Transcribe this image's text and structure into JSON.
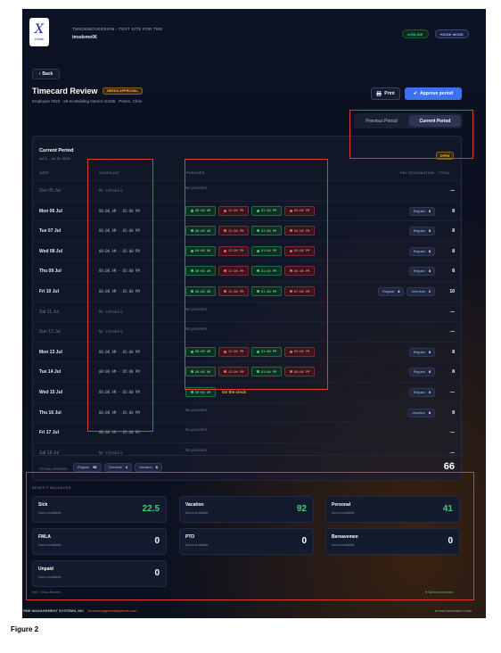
{
  "header": {
    "logo_letter": "X",
    "logo_caption": "Kiosk",
    "site_title": "TMSDEMOVERSION - TEST SITE FOR TMS",
    "site_user": "tmsdemo06",
    "status_online": "ONLINE",
    "status_kiosk": "KIOSK MODE"
  },
  "toolbar": {
    "back_label": "Back",
    "print_label": "Print",
    "approve_label": "Approve period"
  },
  "page": {
    "title": "Timecard Review",
    "approval_badge": "NEEDS APPROVAL",
    "employee_line": "Employee #222 · 20-mi-Building Interior-10185 · Peters, Chris"
  },
  "period_toggle": {
    "previous": "Previous Period",
    "current": "Current Period"
  },
  "card": {
    "title": "Current Period",
    "dates": "Jul 5 – Jul 18, 2026",
    "status": "OPEN",
    "columns": {
      "date": "DATE",
      "schedule": "SCHEDULE",
      "punches": "PUNCHES",
      "pay": "PAY DESIGNATION · TOTAL"
    }
  },
  "rows": [
    {
      "day": "Sun 05 Jul",
      "weekend": true,
      "schedule": "No schedule",
      "punches": [],
      "no_punch": "No punches",
      "on_clock": "",
      "pay": [],
      "total": "—"
    },
    {
      "day": "Mon 06 Jul",
      "weekend": false,
      "schedule": "08:00 AM - 05:00 PM",
      "punches": [
        {
          "t": "08:00 AM",
          "k": "in"
        },
        {
          "t": "12:00 PM",
          "k": "out"
        },
        {
          "t": "01:00 PM",
          "k": "in"
        },
        {
          "t": "05:00 PM",
          "k": "out"
        }
      ],
      "no_punch": "",
      "on_clock": "",
      "pay": [
        {
          "l": "Regular",
          "v": "8"
        }
      ],
      "total": "8"
    },
    {
      "day": "Tue 07 Jul",
      "weekend": false,
      "schedule": "08:00 AM - 05:00 PM",
      "punches": [
        {
          "t": "08:00 AM",
          "k": "in"
        },
        {
          "t": "12:00 PM",
          "k": "out"
        },
        {
          "t": "01:00 PM",
          "k": "in"
        },
        {
          "t": "05:00 PM",
          "k": "out"
        }
      ],
      "no_punch": "",
      "on_clock": "",
      "pay": [
        {
          "l": "Regular",
          "v": "8"
        }
      ],
      "total": "8"
    },
    {
      "day": "Wed 08 Jul",
      "weekend": false,
      "schedule": "08:00 AM - 05:00 PM",
      "punches": [
        {
          "t": "08:00 AM",
          "k": "in"
        },
        {
          "t": "12:00 PM",
          "k": "out"
        },
        {
          "t": "01:00 PM",
          "k": "in"
        },
        {
          "t": "05:00 PM",
          "k": "out"
        }
      ],
      "no_punch": "",
      "on_clock": "",
      "pay": [
        {
          "l": "Regular",
          "v": "8"
        }
      ],
      "total": "8"
    },
    {
      "day": "Thu 09 Jul",
      "weekend": false,
      "schedule": "08:00 AM - 05:00 PM",
      "punches": [
        {
          "t": "08:00 AM",
          "k": "in"
        },
        {
          "t": "12:00 PM",
          "k": "out"
        },
        {
          "t": "01:00 PM",
          "k": "in"
        },
        {
          "t": "05:00 PM",
          "k": "out"
        }
      ],
      "no_punch": "",
      "on_clock": "",
      "pay": [
        {
          "l": "Regular",
          "v": "8"
        }
      ],
      "total": "8"
    },
    {
      "day": "Fri 10 Jul",
      "weekend": false,
      "schedule": "08:00 AM - 05:00 PM",
      "punches": [
        {
          "t": "08:00 AM",
          "k": "in"
        },
        {
          "t": "12:00 PM",
          "k": "out"
        },
        {
          "t": "01:00 PM",
          "k": "in"
        },
        {
          "t": "07:00 PM",
          "k": "out"
        }
      ],
      "no_punch": "",
      "on_clock": "",
      "pay": [
        {
          "l": "Regular",
          "v": "8"
        },
        {
          "l": "Overtime",
          "v": "2"
        }
      ],
      "total": "10"
    },
    {
      "day": "Sat 11 Jul",
      "weekend": true,
      "schedule": "No schedule",
      "punches": [],
      "no_punch": "No punches",
      "on_clock": "",
      "pay": [],
      "total": "—"
    },
    {
      "day": "Sun 12 Jul",
      "weekend": true,
      "schedule": "No schedule",
      "punches": [],
      "no_punch": "No punches",
      "on_clock": "",
      "pay": [],
      "total": "—"
    },
    {
      "day": "Mon 13 Jul",
      "weekend": false,
      "schedule": "08:00 AM - 05:00 PM",
      "punches": [
        {
          "t": "08:00 AM",
          "k": "in"
        },
        {
          "t": "12:00 PM",
          "k": "out"
        },
        {
          "t": "01:00 PM",
          "k": "in"
        },
        {
          "t": "05:00 PM",
          "k": "out"
        }
      ],
      "no_punch": "",
      "on_clock": "",
      "pay": [
        {
          "l": "Regular",
          "v": "8"
        }
      ],
      "total": "8"
    },
    {
      "day": "Tue 14 Jul",
      "weekend": false,
      "schedule": "08:00 AM - 05:00 PM",
      "punches": [
        {
          "t": "08:00 AM",
          "k": "in"
        },
        {
          "t": "12:00 PM",
          "k": "out"
        },
        {
          "t": "01:00 PM",
          "k": "in"
        },
        {
          "t": "05:00 PM",
          "k": "out"
        }
      ],
      "no_punch": "",
      "on_clock": "",
      "pay": [
        {
          "l": "Regular",
          "v": "8"
        }
      ],
      "total": "8"
    },
    {
      "day": "Wed 15 Jul",
      "weekend": false,
      "schedule": "08:00 AM - 05:00 PM",
      "punches": [
        {
          "t": "08:00 AM",
          "k": "in"
        }
      ],
      "no_punch": "",
      "on_clock": "On the clock",
      "pay": [
        {
          "l": "Regular",
          "v": "0"
        }
      ],
      "total": "—"
    },
    {
      "day": "Thu 16 Jul",
      "weekend": false,
      "schedule": "08:00 AM - 05:00 PM",
      "punches": [],
      "no_punch": "No punches",
      "on_clock": "",
      "pay": [
        {
          "l": "Vacation",
          "v": "8"
        }
      ],
      "total": "8"
    },
    {
      "day": "Fri 17 Jul",
      "weekend": false,
      "schedule": "08:00 AM - 05:00 PM",
      "punches": [],
      "no_punch": "No punches",
      "on_clock": "",
      "pay": [],
      "total": "—"
    },
    {
      "day": "Sat 18 Jul",
      "weekend": true,
      "schedule": "No schedule",
      "punches": [],
      "no_punch": "No punches",
      "on_clock": "",
      "pay": [],
      "total": "—"
    }
  ],
  "totals": {
    "label": "TOTAL HOURS",
    "pills": [
      {
        "l": "Regular",
        "v": "56"
      },
      {
        "l": "Overtime",
        "v": "2"
      },
      {
        "l": "Vacation",
        "v": "8"
      }
    ],
    "grand_total": "66"
  },
  "benefits": {
    "heading": "BENEFIT BALANCES",
    "items": [
      {
        "name": "Sick",
        "sub": "hours available",
        "value": "22.5",
        "green": true
      },
      {
        "name": "Vacation",
        "sub": "hours available",
        "value": "92",
        "green": true
      },
      {
        "name": "Personal",
        "sub": "hours available",
        "value": "41",
        "green": true
      },
      {
        "name": "FMLA",
        "sub": "hours available",
        "value": "0",
        "green": false
      },
      {
        "name": "PTO",
        "sub": "hours available",
        "value": "0",
        "green": false
      },
      {
        "name": "Bereavemen",
        "sub": "hours available",
        "value": "0",
        "green": false
      },
      {
        "name": "Unpaid",
        "sub": "hours available",
        "value": "0",
        "green": false
      }
    ]
  },
  "footer": {
    "left": "tms · Kiosk Review",
    "right": "Synced just now",
    "company": "TIME MANAGEMENT SYSTEMS, INC",
    "company_link": "timemanagementsystems.com",
    "ws": "tmsConnection Kiosk"
  },
  "caption": "Figure 2",
  "colors": {
    "accent": "#3b72f0",
    "annotation": "#e03a2a",
    "punch_in": "#33d17a",
    "punch_out": "#ff5a6a",
    "warning": "#f4b545"
  }
}
